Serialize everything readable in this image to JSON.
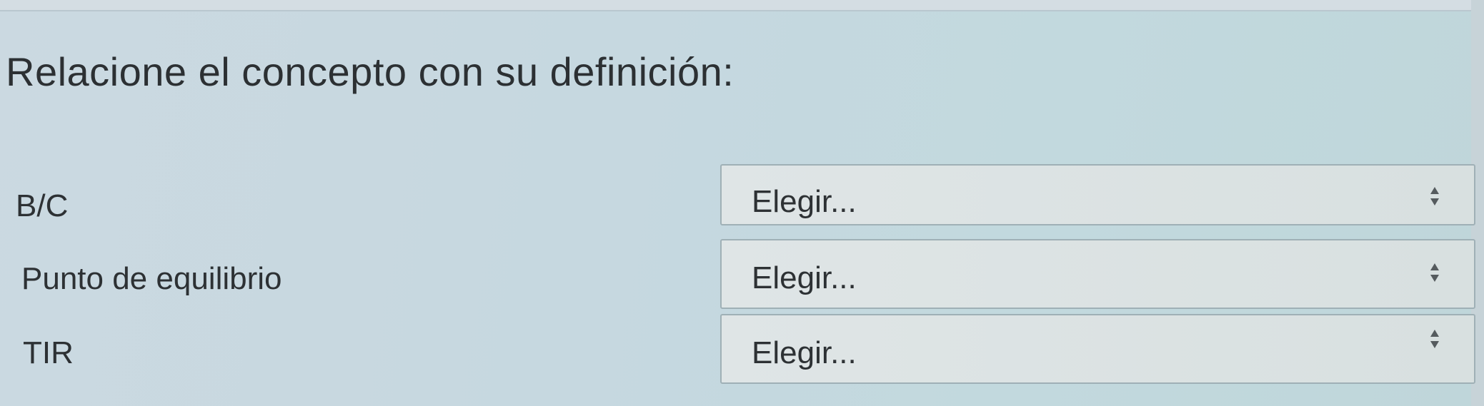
{
  "question": {
    "prompt": "Relacione el concepto con su definición:"
  },
  "matches": [
    {
      "term": "B/C",
      "selected": "Elegir..."
    },
    {
      "term": "Punto de equilibrio",
      "selected": "Elegir..."
    },
    {
      "term": "TIR",
      "selected": "Elegir..."
    }
  ],
  "icons": {
    "select_arrows": "updown-arrows-icon"
  },
  "colors": {
    "background": "#c6d8e0",
    "select_background": "#dde3e4",
    "text": "#2d3134"
  }
}
